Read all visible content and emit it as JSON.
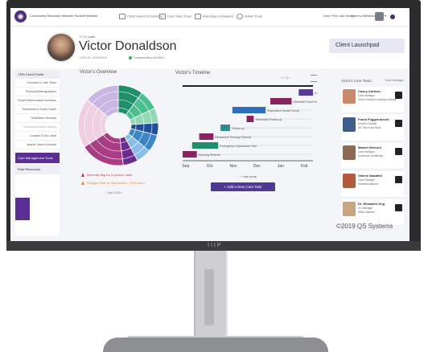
{
  "topbar": {
    "logo_glyph": "◉",
    "org": "Community Resource Network  Student Website",
    "nav": [
      {
        "icon": "search-icon",
        "label": "Client Search & Services"
      },
      {
        "icon": "calendar-icon",
        "label": "Care Team Tools"
      },
      {
        "icon": "chart-icon",
        "label": "Reporting & Analytics"
      },
      {
        "icon": "gear-icon",
        "label": "Admin Tools"
      }
    ],
    "user_name": "User First Last Name",
    "agency": "Agency Affiliation"
  },
  "header": {
    "ct_label": "CT in state",
    "name": "Victor Donaldson",
    "ids": "CRN ID: 00000003",
    "status": "Consent thru 04/2021",
    "launchpad": "Client Launchpad"
  },
  "sidebar": {
    "head": "CRN Client Profile",
    "items": [
      "Overview & Care Team",
      "Personal/Demographics",
      "Social Determinants Summary",
      "Household & Social Graph",
      "Healthcare Records",
      "Behavioral Health History",
      "Consent & Doc Vault",
      "search Victor's records"
    ],
    "care_tools": "Care Management Tools",
    "past_resources": "Past Resources"
  },
  "overview": {
    "title": "Victor's Overview",
    "pager": "‹   Jan 2020   ›",
    "alerts": [
      {
        "text": "Recently flag for in person visits",
        "color": "#d9333f"
      },
      {
        "text": "Flagged Risk for Depression / Self Harm",
        "color": "#f08a24"
      }
    ]
  },
  "timeline": {
    "title": "Victor's Timeline",
    "controls": "‹   1 / 2   ›",
    "months": [
      "Sep",
      "Oct",
      "Nov",
      "Dec",
      "Jan",
      "Feb"
    ],
    "events": [
      {
        "label": "Instructor Appointment",
        "row": 0,
        "start": 4.9,
        "end": 5.5,
        "color": "#5b3a99"
      },
      {
        "label": "Outreach Food Pantry Visit",
        "row": 1,
        "start": 3.7,
        "end": 4.6,
        "color": "#8a2161"
      },
      {
        "label": "Exploration Social Group",
        "row": 2,
        "start": 2.1,
        "end": 3.5,
        "color": "#2b6fbd"
      },
      {
        "label": "Telehealth Follow-up",
        "row": 3,
        "start": 2.7,
        "end": 3.0,
        "color": "#8a2161"
      },
      {
        "label": "Follow-up",
        "row": 4,
        "start": 1.6,
        "end": 2.0,
        "color": "#2b8c8a"
      },
      {
        "label": "Behavioral Therapy Referral",
        "row": 5,
        "start": 0.7,
        "end": 1.3,
        "color": "#8a2161"
      },
      {
        "label": "Emergency Department Visit",
        "row": 6,
        "start": 0.4,
        "end": 1.5,
        "color": "#1f8f6a"
      },
      {
        "label": "Housing Referral",
        "row": 7,
        "start": 0.0,
        "end": 0.6,
        "color": "#8a2161"
      }
    ],
    "load_more": "+ see more",
    "add_label": "+ Add a New Care Task"
  },
  "care_team": {
    "title": "Victor's Care Team",
    "manage": "Team Manager",
    "members": [
      {
        "name": "Casey Carlson",
        "role": "Case Manager",
        "org": "Grand Junction Housing Authority",
        "color": "#c98a6b"
      },
      {
        "name": "Frank Fuggendrecht",
        "role": "Service Provider",
        "org": "On Time Food Bank",
        "color": "#3f5d8a"
      },
      {
        "name": "Marker Merrent",
        "role": "Case Manager",
        "org": "Uniontown Healthcare",
        "color": "#8a6a55"
      },
      {
        "name": "Valerie Nadaffer",
        "role": "Case Manager",
        "org": "Heartwell Alliance",
        "color": "#b45a3b"
      },
      {
        "name": "Dr. Elizabeth Ong",
        "role": "GC Manager",
        "org": "Wilton Alliance",
        "color": "#c7a582"
      }
    ]
  },
  "copyright": "©2019 QS Systems",
  "brand": "IIIP",
  "chart_data": {
    "type": "pie",
    "values": [
      10,
      8,
      6,
      5,
      7,
      6,
      6,
      18,
      20,
      14
    ],
    "colors": [
      "#1f8f6a",
      "#4cbf8f",
      "#8fd9b6",
      "#1d4f9c",
      "#3a86c9",
      "#8bbee6",
      "#6b2c8f",
      "#a93d84",
      "#f0cfe1",
      "#c9b6e2"
    ]
  }
}
